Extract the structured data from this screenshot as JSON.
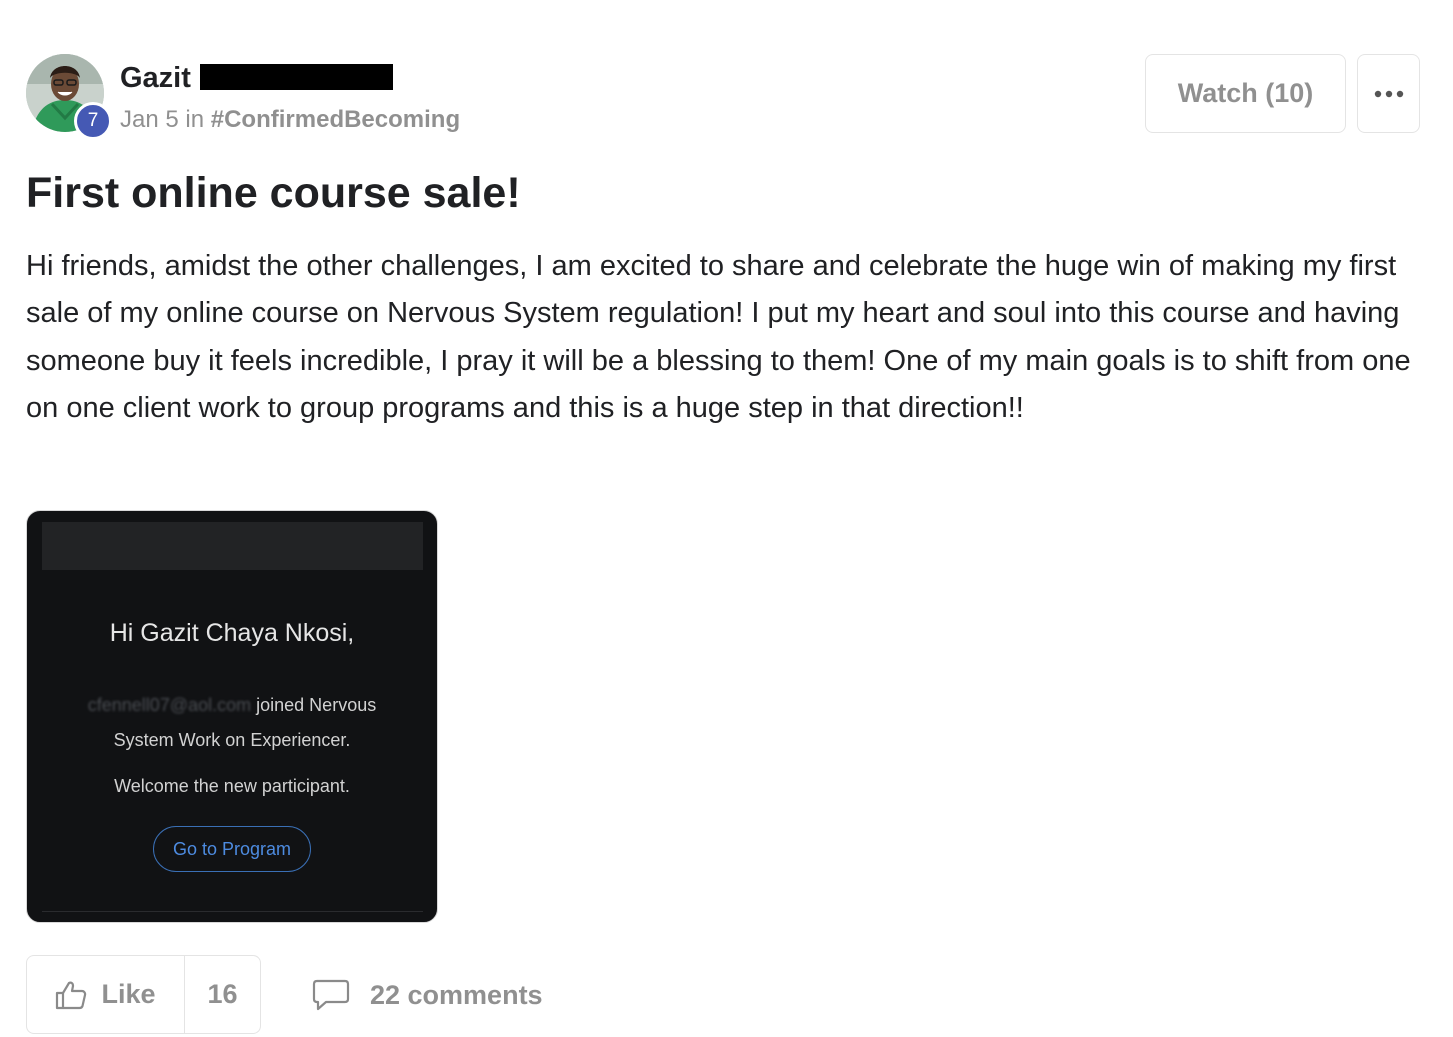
{
  "author": {
    "name": "Gazit",
    "level": "7"
  },
  "meta": {
    "date": "Jan 5",
    "in_word": "in",
    "channel": "#ConfirmedBecoming"
  },
  "actions": {
    "watch_label": "Watch (10)"
  },
  "post": {
    "title": "First online course sale!",
    "body": "Hi friends, amidst the other challenges, I am excited to share and celebrate the huge win of making my first sale of my online course on Nervous System regulation! I put my heart and soul into this course and having someone buy it feels incredible, I pray it will be a blessing to them! One of my main goals is to shift from one on one client work to group programs and this is a huge step in that direction!!"
  },
  "attachment": {
    "greeting": "Hi Gazit Chaya Nkosi,",
    "blurred_email": "cfennell07@aol.com",
    "joined_text": " joined Nervous",
    "line2": "System Work on Experiencer.",
    "welcome": "Welcome the new participant.",
    "button_label": "Go to Program"
  },
  "footer": {
    "like_label": "Like",
    "like_count": "16",
    "comments_label": "22 comments"
  },
  "colors": {
    "badge": "#4559b4",
    "muted_text": "#909090",
    "attachment_bg": "#111214",
    "attachment_button": "#4d8be0"
  },
  "icons": {
    "more": "ellipsis-icon",
    "like": "thumbs-up-icon",
    "comments": "speech-bubble-icon"
  }
}
